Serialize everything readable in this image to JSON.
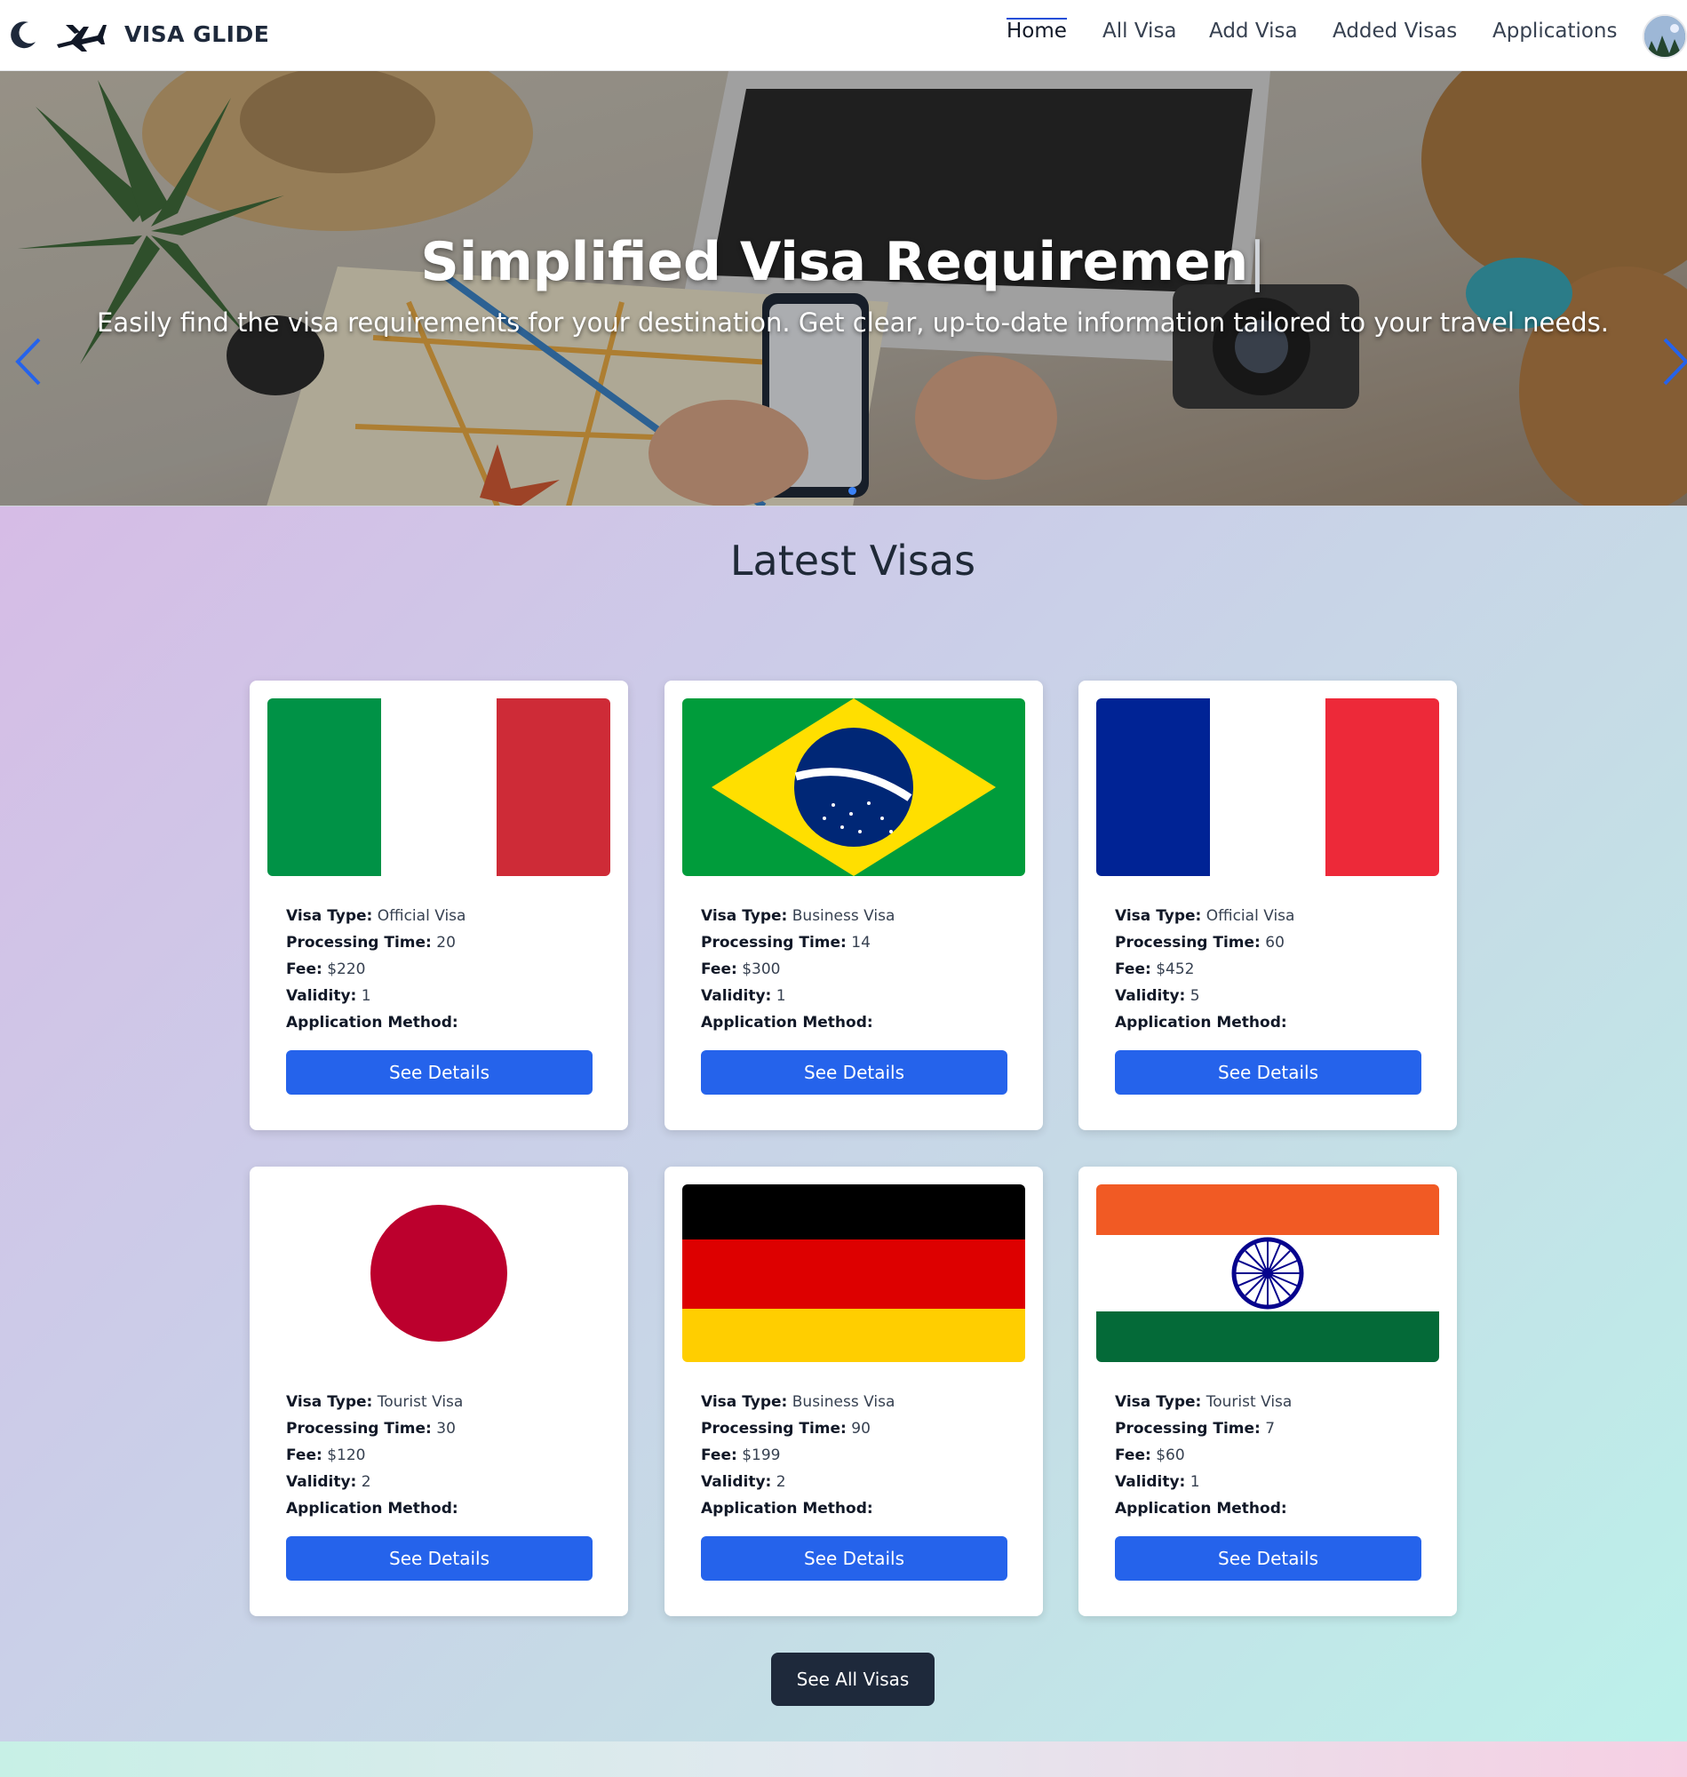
{
  "nav": {
    "brand": "VISA GLIDE",
    "links": [
      {
        "label": "Home",
        "active": true
      },
      {
        "label": "All Visa",
        "active": false
      },
      {
        "label": "Add Visa",
        "active": false
      },
      {
        "label": "Added Visas",
        "active": false
      },
      {
        "label": "Applications",
        "active": false
      }
    ]
  },
  "hero": {
    "title": "Simplified Visa Requiremen",
    "subtitle": "Easily find the visa requirements for your destination. Get clear, up-to-date information tailored to your travel needs."
  },
  "section": {
    "title": "Latest Visas",
    "see_all_label": "See All Visas"
  },
  "labels": {
    "visa_type": "Visa Type:",
    "processing_time": "Processing Time:",
    "fee": "Fee:",
    "validity": "Validity:",
    "application_method": "Application Method:",
    "see_details": "See Details"
  },
  "visas": [
    {
      "flag": "italy-flag",
      "visa_type": "Official Visa",
      "processing_time": "20",
      "fee": "$220",
      "validity": "1",
      "application_method": ""
    },
    {
      "flag": "brazil-flag",
      "visa_type": "Business Visa",
      "processing_time": "14",
      "fee": "$300",
      "validity": "1",
      "application_method": ""
    },
    {
      "flag": "france-flag",
      "visa_type": "Official Visa",
      "processing_time": "60",
      "fee": "$452",
      "validity": "5",
      "application_method": ""
    },
    {
      "flag": "japan-flag",
      "visa_type": "Tourist Visa",
      "processing_time": "30",
      "fee": "$120",
      "validity": "2",
      "application_method": ""
    },
    {
      "flag": "germany-flag",
      "visa_type": "Business Visa",
      "processing_time": "90",
      "fee": "$199",
      "validity": "2",
      "application_method": ""
    },
    {
      "flag": "india-flag",
      "visa_type": "Tourist Visa",
      "processing_time": "7",
      "fee": "$60",
      "validity": "1",
      "application_method": ""
    }
  ],
  "colors": {
    "primary_button": "#2563eb",
    "dark_button": "#1e293b",
    "accent": "#1d4ed8"
  }
}
